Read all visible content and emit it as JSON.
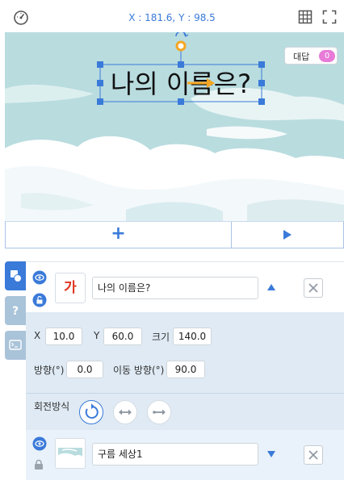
{
  "topbar": {
    "coords": "X : 181.6, Y : 98.5",
    "icons": [
      "speed-icon",
      "grid-icon",
      "fullscreen-icon"
    ]
  },
  "stage": {
    "dialog_label": "대답",
    "dialog_count": "0",
    "text_object": "나의 이름은?"
  },
  "controls": {
    "add_label": "+",
    "icons": [
      "plus-icon",
      "play-icon"
    ]
  },
  "tabs": [
    "objects-tab-icon",
    "help-tab-icon",
    "console-tab-icon"
  ],
  "object1": {
    "thumb_text": "가",
    "name": "나의 이름은?"
  },
  "props": {
    "x_label": "X",
    "x_value": "10.0",
    "y_label": "Y",
    "y_value": "60.0",
    "size_label": "크기",
    "size_value": "140.0",
    "direction_label": "방향(°)",
    "direction_value": "0.0",
    "move_dir_label": "이동 방향(°)",
    "move_dir_value": "90.0"
  },
  "rotation": {
    "label": "회전방식"
  },
  "object2": {
    "name": "구름 세상1"
  },
  "colors": {
    "accent": "#3a7ad9",
    "sky": "#b9dcdf",
    "panel_bg": "#dfeaf4",
    "red_text": "#e0341f",
    "badge": "#e87ad8",
    "handle_orange": "#f5a623"
  }
}
